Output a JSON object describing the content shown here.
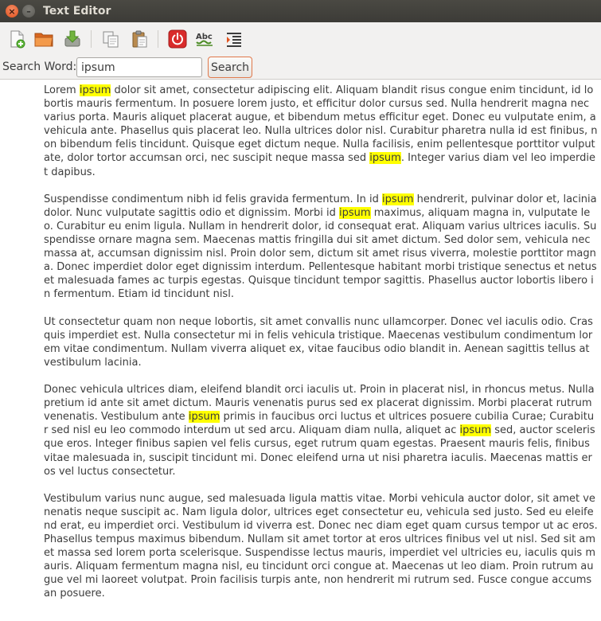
{
  "window": {
    "title": "Text Editor",
    "close_glyph": "×",
    "minimize_glyph": "–"
  },
  "toolbar": {
    "icons": [
      "new-file-icon",
      "open-folder-icon",
      "save-icon",
      "copy-icon",
      "paste-icon",
      "quit-icon",
      "spell-check-icon",
      "indent-icon"
    ],
    "spell_check_label": "Abc"
  },
  "search": {
    "label": "Search Word:",
    "value": "ipsum",
    "button_label": "Search"
  },
  "highlight_color": "#ffff00",
  "document": {
    "paragraphs": [
      [
        "Lorem ",
        {
          "hl": "ipsum"
        },
        " dolor sit amet, consectetur adipiscing elit. Aliquam blandit risus congue enim tincidunt, id lobortis mauris fermentum. In posuere lorem justo, et efficitur dolor cursus sed. Nulla hendrerit magna nec varius porta. Mauris aliquet placerat augue, et bibendum metus efficitur eget. Donec eu vulputate enim, a vehicula ante. Phasellus quis placerat leo. Nulla ultrices dolor nisl. Curabitur pharetra nulla id est finibus, non bibendum felis tincidunt. Quisque eget dictum neque. Nulla facilisis, enim pellentesque porttitor vulputate, dolor tortor accumsan orci, nec suscipit neque massa sed ",
        {
          "hl": "ipsum"
        },
        ". Integer varius diam vel leo imperdiet dapibus."
      ],
      [
        "Suspendisse condimentum nibh id felis gravida fermentum. In id ",
        {
          "hl": "ipsum"
        },
        " hendrerit, pulvinar dolor et, lacinia dolor. Nunc vulputate sagittis odio et dignissim. Morbi id ",
        {
          "hl": "ipsum"
        },
        " maximus, aliquam magna in, vulputate leo. Curabitur eu enim ligula. Nullam in hendrerit dolor, id consequat erat. Aliquam varius ultrices iaculis. Suspendisse ornare magna sem. Maecenas mattis fringilla dui sit amet dictum. Sed dolor sem, vehicula nec massa at, accumsan dignissim nisl. Proin dolor sem, dictum sit amet risus viverra, molestie porttitor magna. Donec imperdiet dolor eget dignissim interdum. Pellentesque habitant morbi tristique senectus et netus et malesuada fames ac turpis egestas. Quisque tincidunt tempor sagittis. Phasellus auctor lobortis libero in fermentum. Etiam id tincidunt nisl."
      ],
      [
        "Ut consectetur quam non neque lobortis, sit amet convallis nunc ullamcorper. Donec vel iaculis odio. Cras quis imperdiet est. Nulla consectetur mi in felis vehicula tristique. Maecenas vestibulum condimentum lorem vitae condimentum. Nullam viverra aliquet ex, vitae faucibus odio blandit in. Aenean sagittis tellus at vestibulum lacinia."
      ],
      [
        "Donec vehicula ultrices diam, eleifend blandit orci iaculis ut. Proin in placerat nisl, in rhoncus metus. Nulla pretium id ante sit amet dictum. Mauris venenatis purus sed ex placerat dignissim. Morbi placerat rutrum venenatis. Vestibulum ante ",
        {
          "hl": "ipsum"
        },
        " primis in faucibus orci luctus et ultrices posuere cubilia Curae; Curabitur sed nisl eu leo commodo interdum ut sed arcu. Aliquam diam nulla, aliquet ac ",
        {
          "hl": "ipsum"
        },
        " sed, auctor scelerisque eros. Integer finibus sapien vel felis cursus, eget rutrum quam egestas. Praesent mauris felis, finibus vitae malesuada in, suscipit tincidunt mi. Donec eleifend urna ut nisi pharetra iaculis. Maecenas mattis eros vel luctus consectetur."
      ],
      [
        "Vestibulum varius nunc augue, sed malesuada ligula mattis vitae. Morbi vehicula auctor dolor, sit amet venenatis neque suscipit ac. Nam ligula dolor, ultrices eget consectetur eu, vehicula sed justo. Sed eu eleifend erat, eu imperdiet orci. Vestibulum id viverra est. Donec nec diam eget quam cursus tempor ut ac eros. Phasellus tempus maximus bibendum. Nullam sit amet tortor at eros ultrices finibus vel ut nisl. Sed sit amet massa sed lorem porta scelerisque. Suspendisse lectus mauris, imperdiet vel ultricies eu, iaculis quis mauris. Aliquam fermentum magna nisl, eu tincidunt orci congue at. Maecenas ut leo diam. Proin rutrum augue vel mi laoreet volutpat. Proin facilisis turpis ante, non hendrerit mi rutrum sed. Fusce congue accumsan posuere."
      ]
    ]
  }
}
